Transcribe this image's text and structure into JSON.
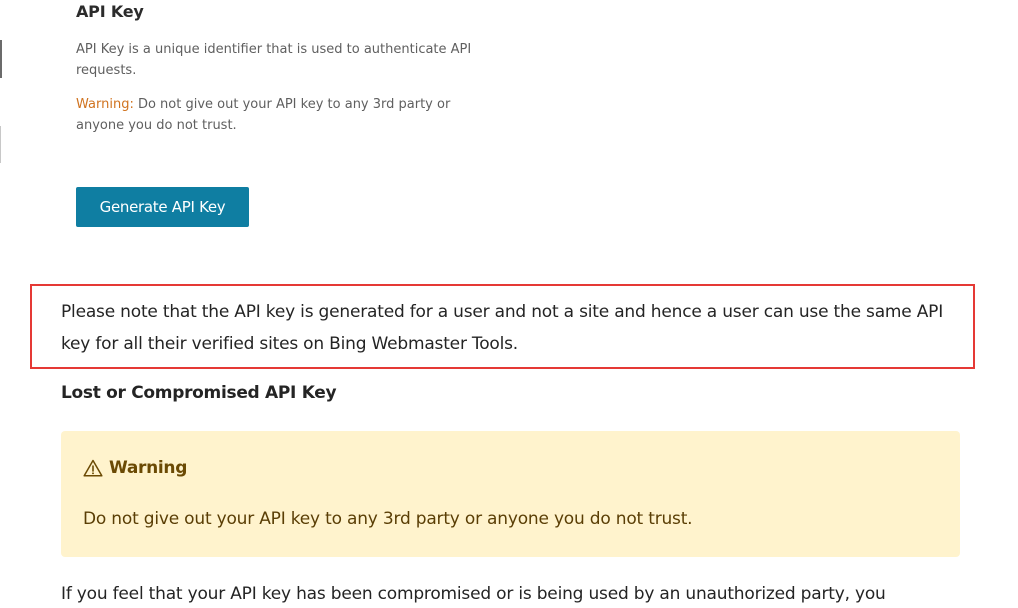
{
  "api_key_card": {
    "title": "API Key",
    "description": "API Key is a unique identifier that is used to authenticate API requests.",
    "warning_label": "Warning:",
    "warning_text": " Do not give out your API key to any 3rd party or anyone you do not trust.",
    "generate_button": "Generate API Key"
  },
  "note": {
    "text": "Please note that the API key is generated for a user and not a site and hence a user can use the same API key for all their verified sites on Bing Webmaster Tools.",
    "highlight_color": "#e53935"
  },
  "lost_section": {
    "heading": "Lost or Compromised API Key",
    "warning_title": "Warning",
    "warning_icon": "warning-triangle-icon",
    "warning_body": "Do not give out your API key to any 3rd party or anyone you do not trust.",
    "panel_color": "#fff3cd"
  },
  "bottom": {
    "text": "If you feel that your API key has been compromised or is being used by an unauthorized party, you"
  },
  "colors": {
    "button": "#0f7ea2",
    "warning_label": "#d0731f"
  }
}
